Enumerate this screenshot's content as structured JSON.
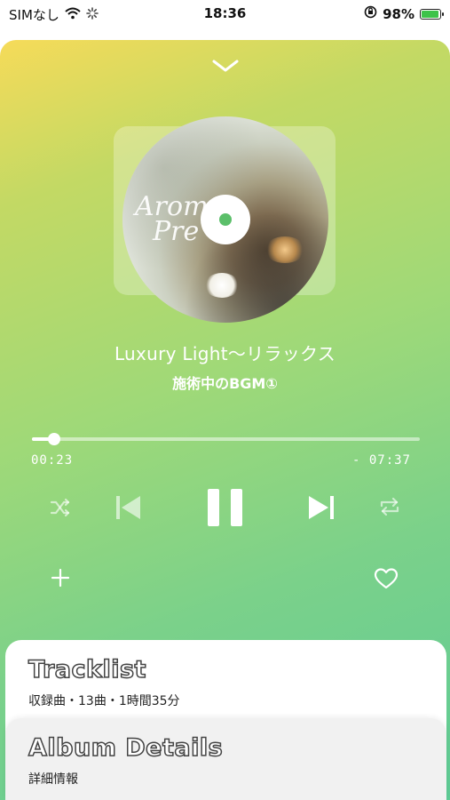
{
  "status_bar": {
    "carrier": "SIMなし",
    "time": "18:36",
    "battery_percent": "98%",
    "battery_level": 0.98
  },
  "player": {
    "album_art_text_line1": "Arom",
    "album_art_text_line2": "Pre",
    "track_title": "Luxury Light〜リラックス",
    "album_subtitle": "施術中のBGM①",
    "elapsed": "00:23",
    "remaining": "- 07:37",
    "progress_fraction": 0.057,
    "gradient_colors": [
      "#f6db59",
      "#9fd978",
      "#5ecb96"
    ]
  },
  "controls": {
    "shuffle": "shuffle-icon",
    "previous": "previous-icon",
    "pause": "pause-icon",
    "next": "next-icon",
    "repeat": "repeat-icon",
    "add": "plus-icon",
    "favorite": "heart-icon"
  },
  "sheets": {
    "tracklist": {
      "title": "Tracklist",
      "subtitle": "収録曲・13曲・1時間35分"
    },
    "album_details": {
      "title": "Album Details",
      "subtitle": "詳細情報"
    }
  }
}
